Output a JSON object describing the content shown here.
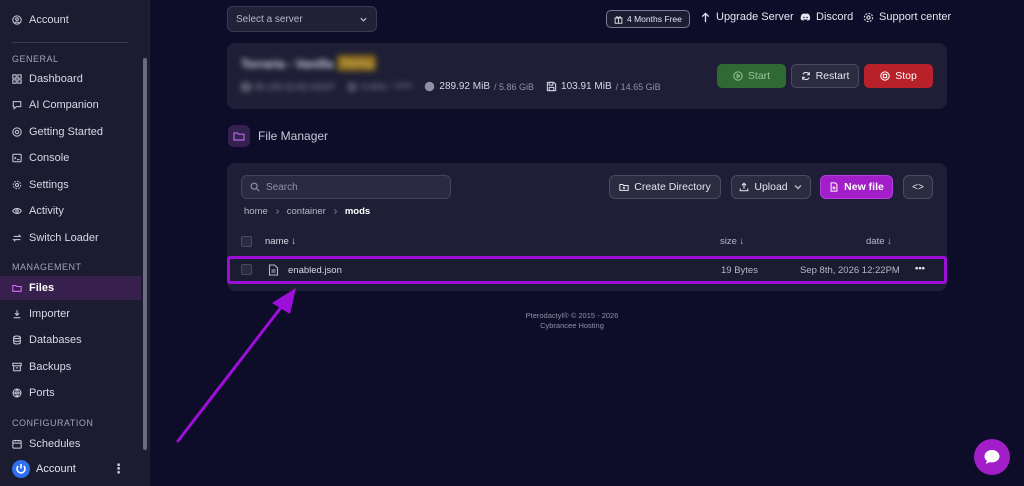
{
  "sidebar": {
    "top_account": "Account",
    "sections": {
      "general": "GENERAL",
      "management": "MANAGEMENT",
      "configuration": "CONFIGURATION"
    },
    "items": {
      "dashboard": "Dashboard",
      "ai": "AI Companion",
      "getting_started": "Getting Started",
      "console": "Console",
      "settings": "Settings",
      "activity": "Activity",
      "switch_loader": "Switch Loader",
      "files": "Files",
      "importer": "Importer",
      "databases": "Databases",
      "backups": "Backups",
      "ports": "Ports",
      "schedules": "Schedules"
    },
    "footer_account": "Account",
    "kebab": "⋮"
  },
  "topbar": {
    "server_select_placeholder": "Select a server",
    "promo_badge": "4 Months Free",
    "upgrade": "Upgrade Server",
    "discord": "Discord",
    "support": "Support center"
  },
  "server": {
    "name": "Terraria - Vanilla",
    "status": "Starting",
    "address": "85.159.32.82:19237",
    "cpu": "0.00%",
    "cpu_limit": "/ 100%",
    "memory": "289.92 MiB",
    "memory_limit": "/ 5.86 GiB",
    "disk": "103.91 MiB",
    "disk_limit": "/ 14.65 GiB",
    "start_label": "Start",
    "restart_label": "Restart",
    "stop_label": "Stop",
    "colors": {
      "start": "#2e6a32",
      "stop": "#b8202a",
      "accent": "#a21ec8"
    }
  },
  "file_manager": {
    "title": "File Manager",
    "search_placeholder": "Search",
    "create_directory": "Create Directory",
    "upload": "Upload",
    "new_file": "New file",
    "code_toggle": "<>",
    "breadcrumb": [
      "home",
      "container",
      "mods"
    ],
    "columns": {
      "name": "name ↓",
      "size": "size ↓",
      "date": "date ↓"
    },
    "rows": [
      {
        "name": "enabled.json",
        "size": "19 Bytes",
        "date": "Sep 8th, 2026 12:22PM",
        "menu": "•••"
      }
    ]
  },
  "footer": {
    "line1": "Pterodactyl® © 2015 - 2026",
    "line2": "Cybrancee Hosting"
  }
}
